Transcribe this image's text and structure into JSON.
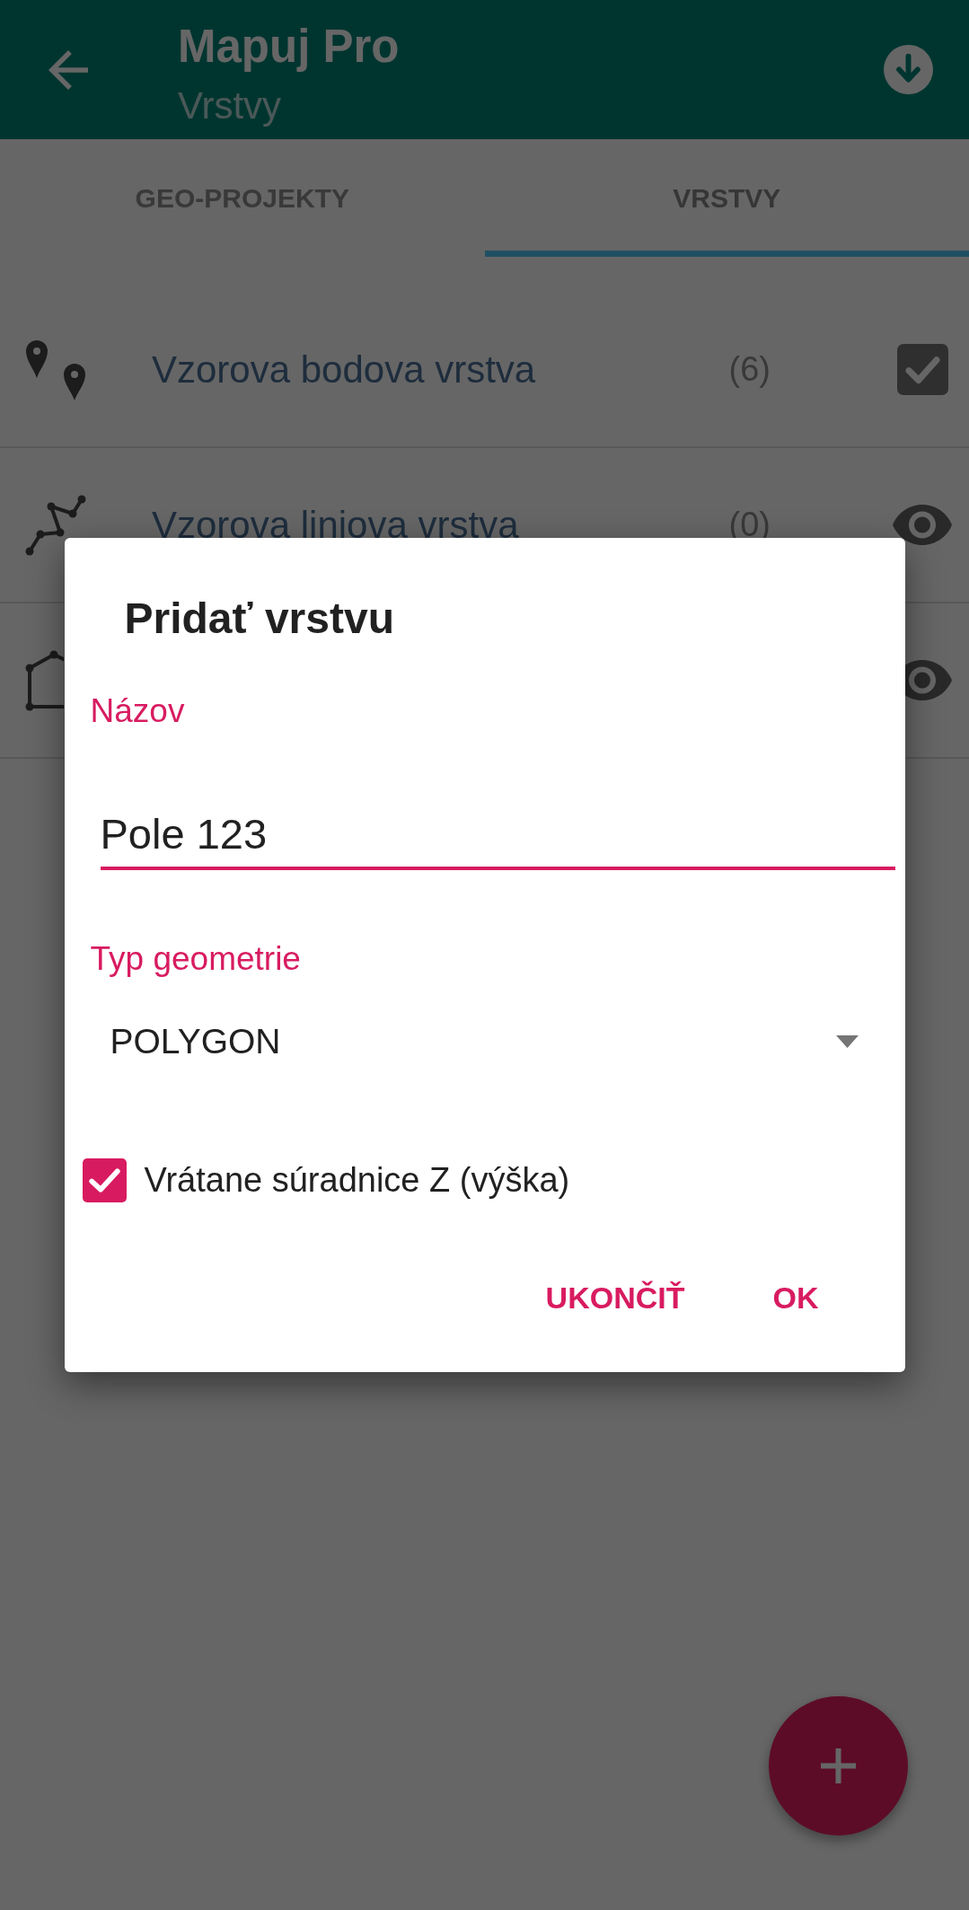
{
  "app_bar": {
    "title": "Mapuj Pro",
    "subtitle": "Vrstvy"
  },
  "tabs": [
    {
      "label": "GEO-PROJEKTY",
      "selected": false
    },
    {
      "label": "VRSTVY",
      "selected": true
    }
  ],
  "layers": [
    {
      "kind": "point",
      "name": "Vzorova bodova vrstva",
      "count": "(6)",
      "selected": true
    },
    {
      "kind": "line",
      "name": "Vzorova liniova vrstva",
      "count": "(0)",
      "selected": false
    },
    {
      "kind": "polygon",
      "selected": false
    }
  ],
  "dialog": {
    "title": "Pridať vrstvu",
    "name_field": {
      "label": "Názov",
      "value": "Pole 123"
    },
    "geometry_field": {
      "label": "Typ geometrie",
      "value": "POLYGON"
    },
    "include_z": {
      "label": "Vrátane súradnice Z (výška)",
      "checked": true
    },
    "buttons": [
      "UKONČIŤ",
      "OK"
    ]
  }
}
